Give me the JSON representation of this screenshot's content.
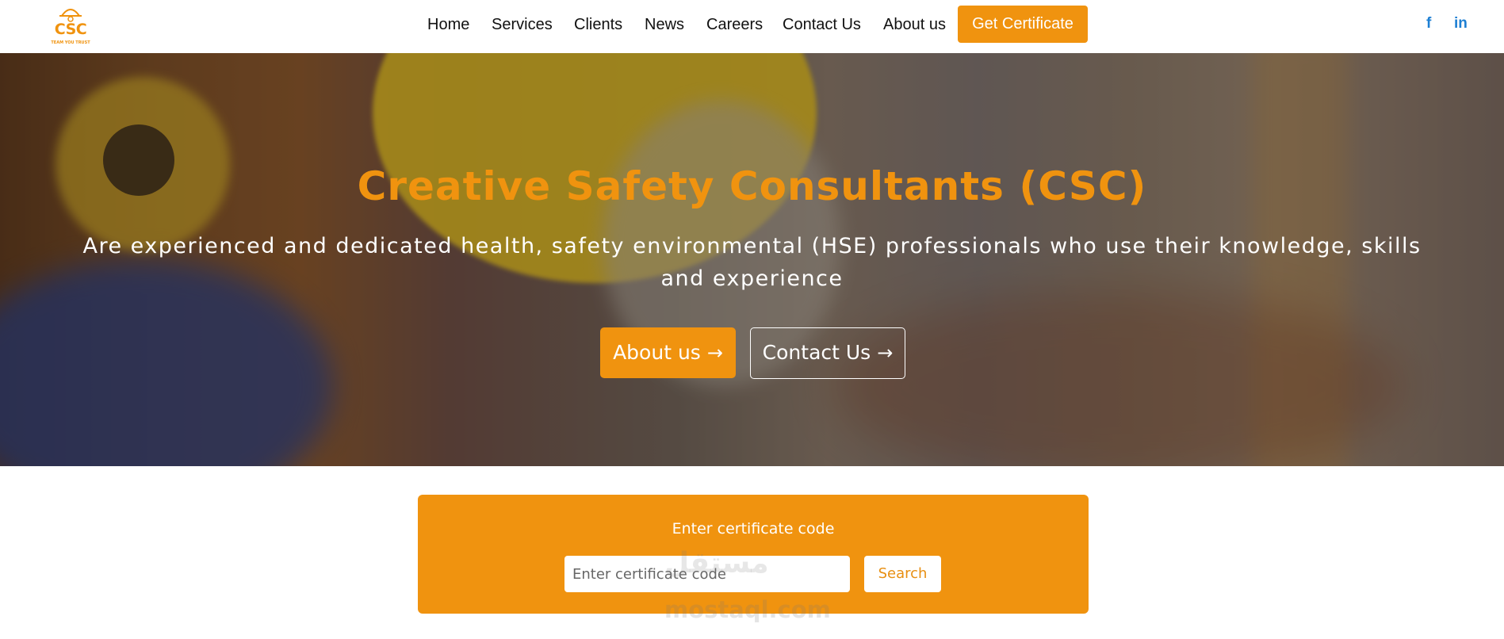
{
  "header": {
    "logo": {
      "text": "CSC",
      "tagline": "TEAM YOU TRUST"
    },
    "nav": [
      "Home",
      "Services",
      "Clients",
      "News",
      "Careers",
      "Contact Us",
      "About us"
    ],
    "cta_label": "Get Certificate",
    "social": {
      "facebook": "f",
      "linkedin": "in"
    }
  },
  "hero": {
    "title": "Creative Safety Consultants (CSC)",
    "subtitle": "Are experienced and dedicated health, safety environmental (HSE) professionals who use their knowledge, skills and experience",
    "buttons": {
      "about": "About us",
      "contact": "Contact Us"
    }
  },
  "certificate": {
    "title": "Enter certificate code",
    "placeholder": "Enter certificate code",
    "search_label": "Search"
  },
  "watermark": {
    "arabic": "مستقل",
    "domain": "mostaql.com"
  },
  "colors": {
    "accent": "#f0930f",
    "social": "#1d7fd3"
  }
}
